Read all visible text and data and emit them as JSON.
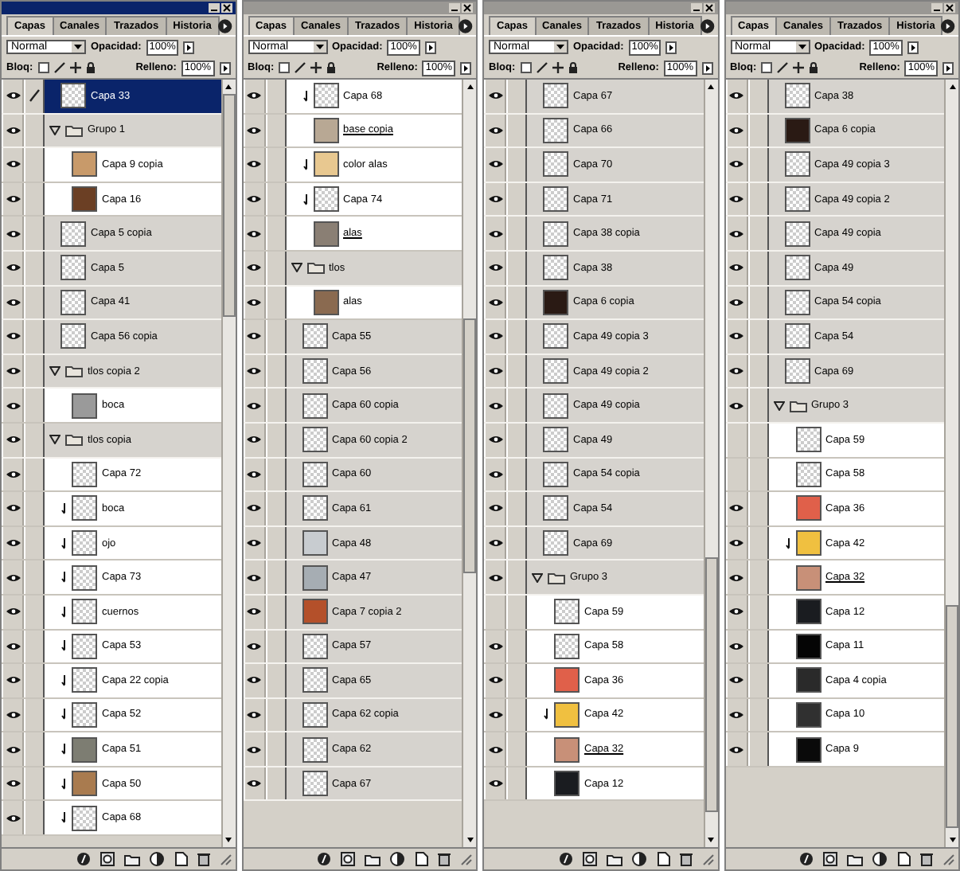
{
  "panels": [
    {
      "active": true,
      "tabs": [
        {
          "label": "Capas",
          "selected": true
        },
        {
          "label": "Canales",
          "selected": false
        },
        {
          "label": "Trazados",
          "selected": false
        },
        {
          "label": "Historia",
          "selected": false
        }
      ],
      "blend_mode": "Normal",
      "opacity_label": "Opacidad:",
      "opacity": "100%",
      "lock_label": "Bloq:",
      "lock_transparency": false,
      "fill_label": "Relleno:",
      "fill": "100%",
      "layers": [
        {
          "kind": "layer",
          "name": "Capa 33",
          "visible": true,
          "clipped": false,
          "underlined": false,
          "selected": true
        },
        {
          "kind": "group",
          "name": "Grupo 1",
          "visible": true,
          "expanded": true,
          "selected": false,
          "children": [
            {
              "kind": "image_layer",
              "name": "Capa 9 copia",
              "color": "#c89a6a",
              "visible": true,
              "clipped": false,
              "underlined": false,
              "selected": false
            },
            {
              "kind": "image_layer",
              "name": "Capa 16",
              "color": "#6b3f24",
              "visible": true,
              "clipped": false,
              "underlined": false,
              "selected": false
            }
          ]
        },
        {
          "kind": "layer",
          "name": "Capa 5 copia",
          "visible": true,
          "clipped": false,
          "underlined": false,
          "selected": false
        },
        {
          "kind": "layer",
          "name": "Capa 5",
          "visible": true,
          "clipped": false,
          "underlined": false,
          "selected": false
        },
        {
          "kind": "layer",
          "name": "Capa 41",
          "visible": true,
          "clipped": false,
          "underlined": false,
          "selected": false
        },
        {
          "kind": "layer",
          "name": "Capa 56 copia",
          "visible": true,
          "clipped": false,
          "underlined": false,
          "selected": false
        },
        {
          "kind": "group",
          "name": "tlos copia 2",
          "visible": true,
          "expanded": true,
          "selected": false,
          "children": [
            {
              "kind": "image_layer",
              "name": "boca",
              "color": "#9a9a9a",
              "visible": true,
              "clipped": false,
              "underlined": false,
              "selected": false
            }
          ]
        },
        {
          "kind": "group",
          "name": "tlos copia",
          "visible": true,
          "expanded": true,
          "selected": false,
          "children": [
            {
              "kind": "layer",
              "name": "Capa 72",
              "visible": true,
              "clipped": false,
              "underlined": false,
              "selected": false
            },
            {
              "kind": "layer",
              "name": "boca",
              "visible": true,
              "clipped": true,
              "underlined": false,
              "selected": false
            },
            {
              "kind": "layer",
              "name": "ojo",
              "visible": true,
              "clipped": true,
              "underlined": false,
              "selected": false
            },
            {
              "kind": "layer",
              "name": "Capa 73",
              "visible": true,
              "clipped": true,
              "underlined": false,
              "selected": false
            },
            {
              "kind": "layer",
              "name": "cuernos",
              "visible": true,
              "clipped": true,
              "underlined": false,
              "selected": false
            },
            {
              "kind": "layer",
              "name": "Capa 53",
              "visible": true,
              "clipped": true,
              "underlined": false,
              "selected": false
            },
            {
              "kind": "layer",
              "name": "Capa 22 copia",
              "visible": true,
              "clipped": true,
              "underlined": false,
              "selected": false
            },
            {
              "kind": "layer",
              "name": "Capa 52",
              "visible": true,
              "clipped": true,
              "underlined": false,
              "selected": false
            },
            {
              "kind": "image_layer",
              "name": "Capa 51",
              "color": "#7d7d72",
              "visible": true,
              "clipped": true,
              "underlined": false,
              "selected": false
            },
            {
              "kind": "image_layer",
              "name": "Capa 50",
              "color": "#a97b4f",
              "visible": true,
              "clipped": true,
              "underlined": false,
              "selected": false
            },
            {
              "kind": "layer",
              "name": "Capa 68",
              "visible": true,
              "clipped": true,
              "underlined": false,
              "selected": false
            }
          ]
        }
      ]
    },
    {
      "active": false,
      "tabs": [
        {
          "label": "Capas",
          "selected": true
        },
        {
          "label": "Canales",
          "selected": false
        },
        {
          "label": "Trazados",
          "selected": false
        },
        {
          "label": "Historia",
          "selected": false
        }
      ],
      "blend_mode": "Normal",
      "opacity_label": "Opacidad:",
      "opacity": "100%",
      "lock_label": "Bloq:",
      "lock_transparency": false,
      "fill_label": "Relleno:",
      "fill": "100%",
      "layers": [
        {
          "kind": "group_tail",
          "children": [
            {
              "kind": "layer",
              "name": "Capa 68",
              "visible": true,
              "clipped": true,
              "underlined": false,
              "selected": false
            },
            {
              "kind": "image_layer",
              "name": "base copia",
              "color": "#b8a894",
              "visible": true,
              "clipped": false,
              "underlined": true,
              "selected": false
            },
            {
              "kind": "image_layer",
              "name": "color alas",
              "color": "#e8c890",
              "visible": true,
              "clipped": true,
              "underlined": false,
              "selected": false
            },
            {
              "kind": "layer",
              "name": "Capa 74",
              "visible": true,
              "clipped": true,
              "underlined": false,
              "selected": false
            },
            {
              "kind": "image_layer",
              "name": "alas",
              "color": "#8a7f74",
              "visible": true,
              "clipped": false,
              "underlined": true,
              "selected": false
            }
          ]
        },
        {
          "kind": "group",
          "name": "tlos",
          "visible": true,
          "expanded": true,
          "selected": false,
          "children": [
            {
              "kind": "image_layer",
              "name": "alas",
              "color": "#8a6a50",
              "visible": true,
              "clipped": false,
              "underlined": false,
              "selected": false
            }
          ]
        },
        {
          "kind": "layer",
          "name": "Capa 55",
          "visible": true,
          "clipped": false,
          "underlined": false,
          "selected": false
        },
        {
          "kind": "layer",
          "name": "Capa 56",
          "visible": true,
          "clipped": false,
          "underlined": false,
          "selected": false
        },
        {
          "kind": "layer",
          "name": "Capa 60 copia",
          "visible": true,
          "clipped": false,
          "underlined": false,
          "selected": false
        },
        {
          "kind": "layer",
          "name": "Capa 60 copia 2",
          "visible": true,
          "clipped": false,
          "underlined": false,
          "selected": false
        },
        {
          "kind": "layer",
          "name": "Capa 60",
          "visible": true,
          "clipped": false,
          "underlined": false,
          "selected": false
        },
        {
          "kind": "layer",
          "name": "Capa 61",
          "visible": true,
          "clipped": false,
          "underlined": false,
          "selected": false
        },
        {
          "kind": "image_layer",
          "name": "Capa 48",
          "color": "#c8ccd0",
          "visible": true,
          "clipped": false,
          "underlined": false,
          "selected": false
        },
        {
          "kind": "image_layer",
          "name": "Capa 47",
          "color": "#a6adb3",
          "visible": true,
          "clipped": false,
          "underlined": false,
          "selected": false
        },
        {
          "kind": "image_layer",
          "name": "Capa 7 copia 2",
          "color": "#b4502a",
          "visible": true,
          "clipped": false,
          "underlined": false,
          "selected": false
        },
        {
          "kind": "layer",
          "name": "Capa 57",
          "visible": true,
          "clipped": false,
          "underlined": false,
          "selected": false
        },
        {
          "kind": "layer",
          "name": "Capa 65",
          "visible": true,
          "clipped": false,
          "underlined": false,
          "selected": false
        },
        {
          "kind": "layer",
          "name": "Capa 62 copia",
          "visible": true,
          "clipped": false,
          "underlined": false,
          "selected": false
        },
        {
          "kind": "layer",
          "name": "Capa 62",
          "visible": true,
          "clipped": false,
          "underlined": false,
          "selected": false
        },
        {
          "kind": "layer",
          "name": "Capa 67",
          "visible": true,
          "clipped": false,
          "underlined": false,
          "selected": false
        }
      ]
    },
    {
      "active": false,
      "tabs": [
        {
          "label": "Capas",
          "selected": true
        },
        {
          "label": "Canales",
          "selected": false
        },
        {
          "label": "Trazados",
          "selected": false
        },
        {
          "label": "Historia",
          "selected": false
        }
      ],
      "blend_mode": "Normal",
      "opacity_label": "Opacidad:",
      "opacity": "100%",
      "lock_label": "Bloq:",
      "lock_transparency": false,
      "fill_label": "Relleno:",
      "fill": "100%",
      "layers": [
        {
          "kind": "layer",
          "name": "Capa 67",
          "visible": true,
          "clipped": false,
          "underlined": false,
          "selected": false
        },
        {
          "kind": "layer",
          "name": "Capa 66",
          "visible": true,
          "clipped": false,
          "underlined": false,
          "selected": false
        },
        {
          "kind": "layer",
          "name": "Capa 70",
          "visible": true,
          "clipped": false,
          "underlined": false,
          "selected": false
        },
        {
          "kind": "layer",
          "name": "Capa 71",
          "visible": true,
          "clipped": false,
          "underlined": false,
          "selected": false
        },
        {
          "kind": "layer",
          "name": "Capa 38 copia",
          "visible": true,
          "clipped": false,
          "underlined": false,
          "selected": false
        },
        {
          "kind": "layer",
          "name": "Capa 38",
          "visible": true,
          "clipped": false,
          "underlined": false,
          "selected": false
        },
        {
          "kind": "image_layer",
          "name": "Capa 6 copia",
          "color": "#2a1a14",
          "visible": true,
          "clipped": false,
          "underlined": false,
          "selected": false
        },
        {
          "kind": "layer",
          "name": "Capa 49 copia 3",
          "visible": true,
          "clipped": false,
          "underlined": false,
          "selected": false
        },
        {
          "kind": "layer",
          "name": "Capa 49 copia 2",
          "visible": true,
          "clipped": false,
          "underlined": false,
          "selected": false
        },
        {
          "kind": "layer",
          "name": "Capa 49 copia",
          "visible": true,
          "clipped": false,
          "underlined": false,
          "selected": false
        },
        {
          "kind": "layer",
          "name": "Capa 49",
          "visible": true,
          "clipped": false,
          "underlined": false,
          "selected": false
        },
        {
          "kind": "layer",
          "name": "Capa 54 copia",
          "visible": true,
          "clipped": false,
          "underlined": false,
          "selected": false
        },
        {
          "kind": "layer",
          "name": "Capa 54",
          "visible": true,
          "clipped": false,
          "underlined": false,
          "selected": false
        },
        {
          "kind": "layer",
          "name": "Capa 69",
          "visible": true,
          "clipped": false,
          "underlined": false,
          "selected": false
        },
        {
          "kind": "group",
          "name": "Grupo 3",
          "visible": true,
          "expanded": true,
          "selected": false,
          "children": [
            {
              "kind": "layer",
              "name": "Capa 59",
              "visible": false,
              "clipped": false,
              "underlined": false,
              "selected": false
            },
            {
              "kind": "layer",
              "name": "Capa 58",
              "visible": true,
              "clipped": false,
              "underlined": false,
              "selected": false
            },
            {
              "kind": "image_layer",
              "name": "Capa 36",
              "color": "#e0604a",
              "visible": true,
              "clipped": false,
              "underlined": false,
              "selected": false
            },
            {
              "kind": "image_layer",
              "name": "Capa 42",
              "color": "#f0c040",
              "visible": true,
              "clipped": true,
              "underlined": false,
              "selected": false
            },
            {
              "kind": "image_layer",
              "name": "Capa 32",
              "color": "#c89078",
              "visible": true,
              "clipped": false,
              "underlined": true,
              "selected": false
            },
            {
              "kind": "image_layer",
              "name": "Capa 12",
              "color": "#1a1c20",
              "visible": true,
              "clipped": false,
              "underlined": false,
              "selected": false
            }
          ]
        }
      ]
    },
    {
      "active": false,
      "tabs": [
        {
          "label": "Capas",
          "selected": true
        },
        {
          "label": "Canales",
          "selected": false
        },
        {
          "label": "Trazados",
          "selected": false
        },
        {
          "label": "Historia",
          "selected": false
        }
      ],
      "blend_mode": "Normal",
      "opacity_label": "Opacidad:",
      "opacity": "100%",
      "lock_label": "Bloq:",
      "lock_transparency": false,
      "fill_label": "Relleno:",
      "fill": "100%",
      "layers": [
        {
          "kind": "layer",
          "name": "Capa 38",
          "visible": true,
          "clipped": false,
          "underlined": false,
          "selected": false
        },
        {
          "kind": "image_layer",
          "name": "Capa 6 copia",
          "color": "#2a1a14",
          "visible": true,
          "clipped": false,
          "underlined": false,
          "selected": false
        },
        {
          "kind": "layer",
          "name": "Capa 49 copia 3",
          "visible": true,
          "clipped": false,
          "underlined": false,
          "selected": false
        },
        {
          "kind": "layer",
          "name": "Capa 49 copia 2",
          "visible": true,
          "clipped": false,
          "underlined": false,
          "selected": false
        },
        {
          "kind": "layer",
          "name": "Capa 49 copia",
          "visible": true,
          "clipped": false,
          "underlined": false,
          "selected": false
        },
        {
          "kind": "layer",
          "name": "Capa 49",
          "visible": true,
          "clipped": false,
          "underlined": false,
          "selected": false
        },
        {
          "kind": "layer",
          "name": "Capa 54 copia",
          "visible": true,
          "clipped": false,
          "underlined": false,
          "selected": false
        },
        {
          "kind": "layer",
          "name": "Capa 54",
          "visible": true,
          "clipped": false,
          "underlined": false,
          "selected": false
        },
        {
          "kind": "layer",
          "name": "Capa 69",
          "visible": true,
          "clipped": false,
          "underlined": false,
          "selected": false
        },
        {
          "kind": "group",
          "name": "Grupo 3",
          "visible": true,
          "expanded": true,
          "selected": false,
          "children": [
            {
              "kind": "layer",
              "name": "Capa 59",
              "visible": false,
              "clipped": false,
              "underlined": false,
              "selected": false
            },
            {
              "kind": "layer",
              "name": "Capa 58",
              "visible": false,
              "clipped": false,
              "underlined": false,
              "selected": false
            },
            {
              "kind": "image_layer",
              "name": "Capa 36",
              "color": "#e0604a",
              "visible": true,
              "clipped": false,
              "underlined": false,
              "selected": false
            },
            {
              "kind": "image_layer",
              "name": "Capa 42",
              "color": "#f0c040",
              "visible": true,
              "clipped": true,
              "underlined": false,
              "selected": false
            },
            {
              "kind": "image_layer",
              "name": "Capa 32",
              "color": "#c89078",
              "visible": true,
              "clipped": false,
              "underlined": true,
              "selected": false
            },
            {
              "kind": "image_layer",
              "name": "Capa 12",
              "color": "#1a1c20",
              "visible": true,
              "clipped": false,
              "underlined": false,
              "selected": false
            },
            {
              "kind": "image_layer",
              "name": "Capa 11",
              "color": "#050505",
              "visible": true,
              "clipped": false,
              "underlined": false,
              "selected": false
            },
            {
              "kind": "image_layer",
              "name": "Capa 4 copia",
              "color": "#2a2a2a",
              "visible": true,
              "clipped": false,
              "underlined": false,
              "selected": false
            },
            {
              "kind": "image_layer",
              "name": "Capa 10",
              "color": "#303030",
              "visible": true,
              "clipped": false,
              "underlined": false,
              "selected": false
            },
            {
              "kind": "image_layer",
              "name": "Capa 9",
              "color": "#0a0a0a",
              "visible": true,
              "clipped": false,
              "underlined": false,
              "selected": false
            }
          ]
        }
      ]
    }
  ]
}
